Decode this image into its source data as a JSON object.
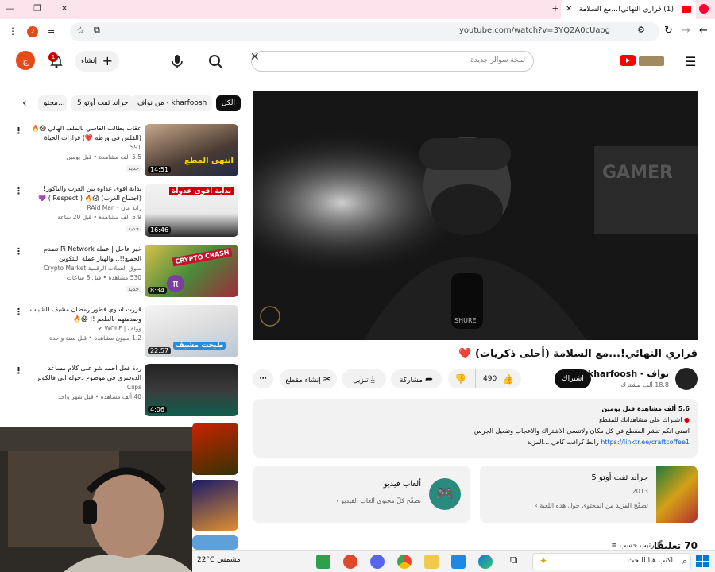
{
  "browser": {
    "tab_title": "(1) قراري النهائي!...مع السلامة",
    "url": "youtube.com/watch?v=3YQ2A0cUaog",
    "profile_badge": "2"
  },
  "header": {
    "search_placeholder": "لمحة سوالز جديدة",
    "create_label": "إنشاء",
    "notification_count": "1",
    "avatar_letter": "ج"
  },
  "chips": [
    "الكل",
    "من نواف - kharfoosh",
    "جراند ثفت أوتو 5",
    "محتو..."
  ],
  "video": {
    "title": "قراري النهائي!...مع السلامة (أحلى ذكريات)",
    "title_emoji": "❤️",
    "channel_name": "نواف - kharfoosh",
    "subscribers": "18.8 ألف مشترك",
    "subscribe_label": "اشتراك",
    "likes": "490",
    "share_label": "مشاركة",
    "download_label": "تنزيل",
    "clip_label": "إنشاء مقطع"
  },
  "description": {
    "stats": "5.6 ألف مشاهدة  قبل يومين",
    "line1": "اشتراك على مشاهداتك للمقطع",
    "line2": "اتمنى انكم تنشر المقطع في كل مكان ولاتنسى الاشتراك والاعجاب وتفعيل الجرس",
    "link": "https://linktr.ee/craftcoffee1",
    "line3": "رابط كرافت كافي    ...المزيد"
  },
  "cards": [
    {
      "title": "جراند ثفت أوتو 5",
      "sub": "2013",
      "more": "تصفّح المزيد من المحتوى حول هذه اللعبة"
    },
    {
      "title": "ألعاب فيديو",
      "sub": "",
      "more": "تصفّح كلّ محتوى ألعاب الفيديو"
    }
  ],
  "comments": {
    "count": "70 تعليقًا",
    "sort_label": "الترتيب حسب"
  },
  "sidebar": [
    {
      "title": "عقاب بطالب الفاسي بالملف الهالي 😱🔥 (الفلس في ورطة ❤️) قرارات الحياة الواقعية...",
      "channel": "S9T",
      "meta": "5.5 ألف مشاهدة • قبل يومين",
      "badge": "جديد",
      "duration": "14:51"
    },
    {
      "title": "بداية اقوى عداوة بين الغرب والباكوز!(اجتماع الغرب) 😱🔥 ( Respect ) 💜🔥...",
      "channel": "راند مان - RAid Man",
      "meta": "5.9 ألف مشاهدة • قبل 20 ساعة",
      "badge": "جديد",
      "duration": "16:46"
    },
    {
      "title": "خبر عاجل | عملة Pi Network تصدم الجميع!!.. والهيار عملة البتكوين والكريبتو...",
      "channel": "سوق العملات الرقمية Crypto Market",
      "meta": "530 مشاهدة • قبل 8 ساعات",
      "badge": "جديد",
      "duration": "8:34"
    },
    {
      "title": "قررت اسوي فطور رمضان مشبف للشباب وصدمتهم بالطعم !! 😱🔥",
      "channel": "وولف | WOLF",
      "meta": "1.2 مليون مشاهدة • قبل سنة واحدة",
      "badge": "",
      "duration": "22:57"
    },
    {
      "title": "ردة فعل احمد شو على كلام مساعد الدوسري في موضوع دخوله الى فالكونز 😢",
      "channel": "Clips",
      "meta": "40 ألف مشاهدة • قبل شهر واحد",
      "badge": "",
      "duration": "4:06"
    }
  ],
  "thumb_texts": [
    "انتهى المطع",
    "بداية اقوى عدواة",
    "CRYPTO CRASH",
    "طبخت مشبف",
    ""
  ],
  "taskbar": {
    "search_placeholder": "اكتب هنا للبحث",
    "weather": "22°C مشمس"
  }
}
